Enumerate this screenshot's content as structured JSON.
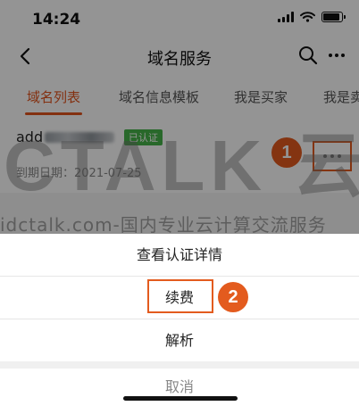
{
  "status_bar": {
    "time": "14:24"
  },
  "nav": {
    "title": "域名服务"
  },
  "tabs": [
    {
      "label": "域名列表",
      "active": true
    },
    {
      "label": "域名信息模板",
      "active": false
    },
    {
      "label": "我是买家",
      "active": false
    },
    {
      "label": "我是卖",
      "active": false
    }
  ],
  "domain_card": {
    "domain_prefix": "add",
    "badge": "已认证",
    "expiry": "到期日期：2021-07-25"
  },
  "watermark": {
    "logo": "CTALK 云",
    "text": "idctalk.com-国内专业云计算交流服务"
  },
  "markers": {
    "one": "1",
    "two": "2"
  },
  "action_sheet": {
    "items": [
      "查看认证详情",
      "续费",
      "解析"
    ],
    "cancel": "取消"
  },
  "colors": {
    "accent": "#e2531c",
    "badge_green": "#46b349",
    "annotation_orange": "#e35b1e"
  }
}
